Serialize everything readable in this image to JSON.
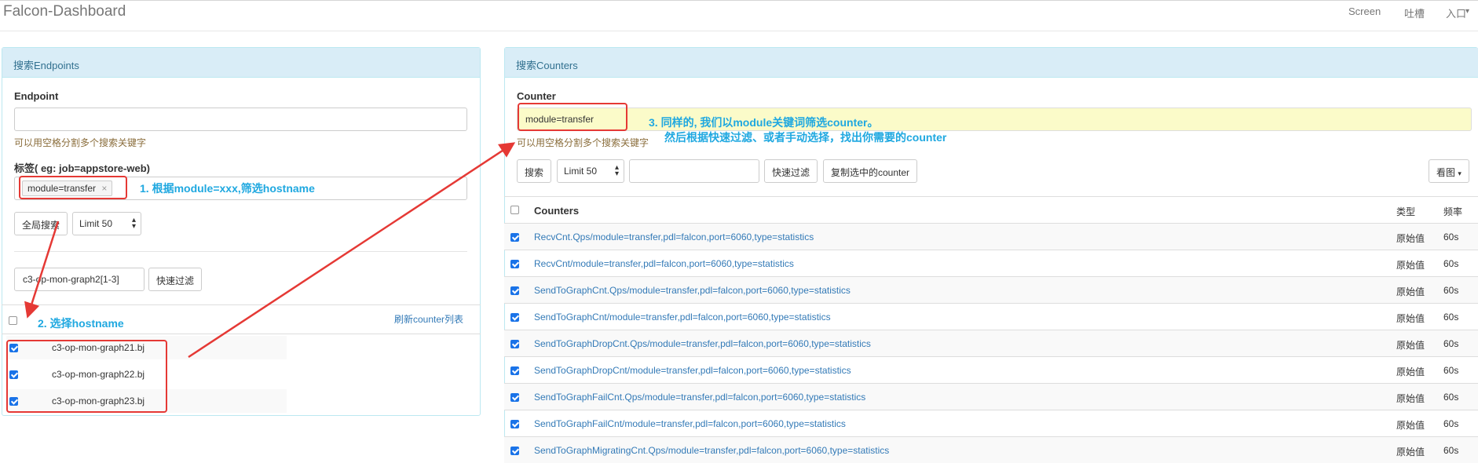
{
  "navbar": {
    "brand": "Falcon-Dashboard",
    "links": [
      "Screen",
      "吐槽",
      "入口"
    ],
    "dropdown_caret": "▾"
  },
  "endpoints_panel": {
    "title": "搜索Endpoints",
    "endpoint_label": "Endpoint",
    "endpoint_value": "",
    "endpoint_help": "可以用空格分割多个搜索关键字",
    "tag_label": "标签( eg: job=appstore-web)",
    "tag_chip": "module=transfer",
    "tag_chip_remove": "×",
    "search_all_button": "全局搜索",
    "limit_select": "Limit 50",
    "filter_input_value": "c3-op-mon-graph2[1-3]",
    "quick_filter_button": "快速过滤",
    "refresh_link": "刷新counter列表",
    "hosts": [
      {
        "name": "c3-op-mon-graph21.bj",
        "checked": true
      },
      {
        "name": "c3-op-mon-graph22.bj",
        "checked": true
      },
      {
        "name": "c3-op-mon-graph23.bj",
        "checked": true
      }
    ]
  },
  "counters_panel": {
    "title": "搜索Counters",
    "counter_label": "Counter",
    "counter_value": "module=transfer",
    "counter_help": "可以用空格分割多个搜索关键字",
    "search_button": "搜索",
    "limit_select": "Limit 50",
    "filter_input_value": "",
    "quick_filter_button": "快速过滤",
    "copy_button": "复制选中的counter",
    "view_button": "看图",
    "table": {
      "headers": [
        "Counters",
        "类型",
        "频率"
      ],
      "rows": [
        {
          "counter": "RecvCnt.Qps/module=transfer,pdl=falcon,port=6060,type=statistics",
          "type": "原始值",
          "freq": "60s"
        },
        {
          "counter": "RecvCnt/module=transfer,pdl=falcon,port=6060,type=statistics",
          "type": "原始值",
          "freq": "60s"
        },
        {
          "counter": "SendToGraphCnt.Qps/module=transfer,pdl=falcon,port=6060,type=statistics",
          "type": "原始值",
          "freq": "60s"
        },
        {
          "counter": "SendToGraphCnt/module=transfer,pdl=falcon,port=6060,type=statistics",
          "type": "原始值",
          "freq": "60s"
        },
        {
          "counter": "SendToGraphDropCnt.Qps/module=transfer,pdl=falcon,port=6060,type=statistics",
          "type": "原始值",
          "freq": "60s"
        },
        {
          "counter": "SendToGraphDropCnt/module=transfer,pdl=falcon,port=6060,type=statistics",
          "type": "原始值",
          "freq": "60s"
        },
        {
          "counter": "SendToGraphFailCnt.Qps/module=transfer,pdl=falcon,port=6060,type=statistics",
          "type": "原始值",
          "freq": "60s"
        },
        {
          "counter": "SendToGraphFailCnt/module=transfer,pdl=falcon,port=6060,type=statistics",
          "type": "原始值",
          "freq": "60s"
        },
        {
          "counter": "SendToGraphMigratingCnt.Qps/module=transfer,pdl=falcon,port=6060,type=statistics",
          "type": "原始值",
          "freq": "60s"
        }
      ]
    }
  },
  "annotations": {
    "step1": "1. 根据module=xxx,筛选hostname",
    "step2": "2. 选择hostname",
    "step3_line1": "3. 同样的, 我们以module关键词筛选counter。",
    "step3_line2": "然后根据快速过滤、或者手动选择，找出你需要的counter"
  },
  "colors": {
    "accent_red": "#e53935",
    "annotation_blue": "#1fa8e0",
    "panel_header_bg": "#d9edf7",
    "link_blue": "#337ab7",
    "checkbox_blue": "#1a73e8"
  }
}
